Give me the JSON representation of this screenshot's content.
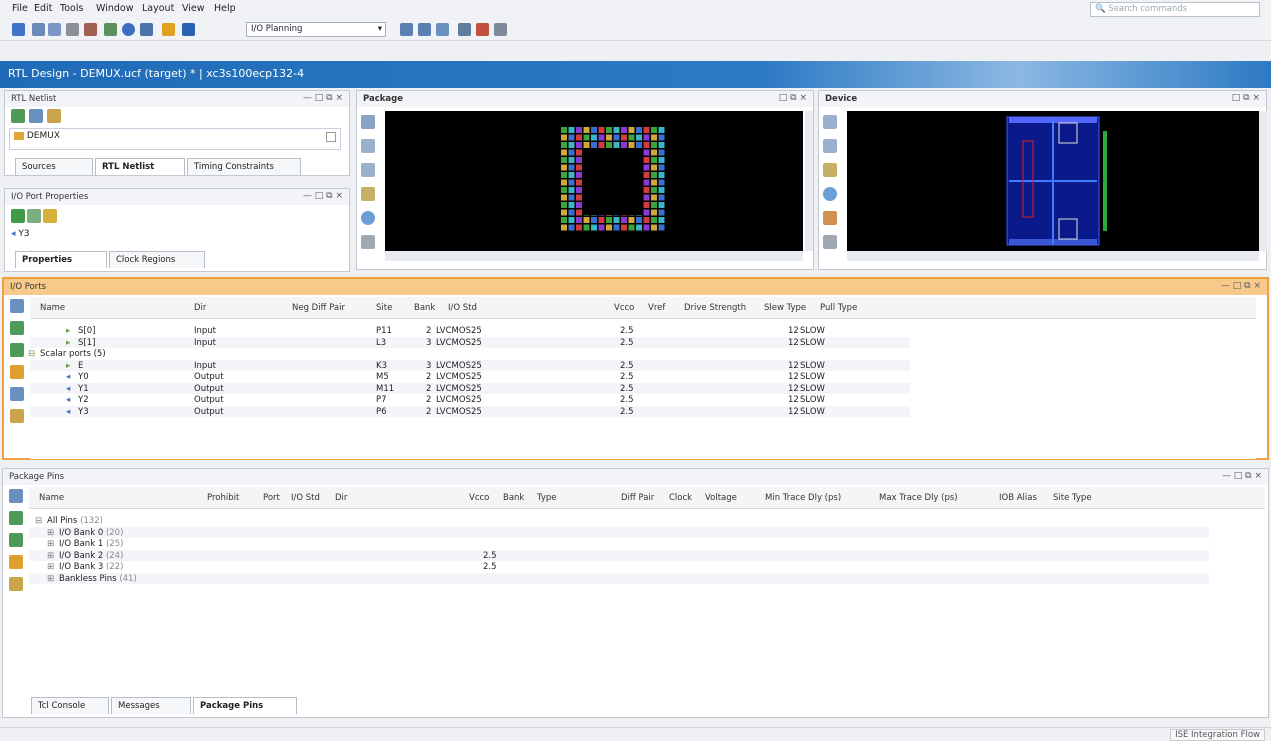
{
  "menu": [
    "File",
    "Edit",
    "Tools",
    "Window",
    "Layout",
    "View",
    "Help"
  ],
  "search_placeholder": "Search commands",
  "layout_select": "I/O Planning",
  "title": "RTL Design - DEMUX.ucf (target) * | xc3s100ecp132-4",
  "rtl_netlist": {
    "title": "RTL Netlist",
    "tree_item": "DEMUX",
    "tabs": [
      "Sources",
      "RTL Netlist",
      "Timing Constraints"
    ]
  },
  "io_port_props": {
    "title": "I/O Port Properties",
    "item": "Y3",
    "tabs": [
      "Properties",
      "Clock Regions"
    ]
  },
  "package_panel": {
    "title": "Package"
  },
  "device_panel": {
    "title": "Device"
  },
  "io_ports": {
    "title": "I/O Ports",
    "columns": [
      "Name",
      "Dir",
      "Neg Diff Pair",
      "Site",
      "Bank",
      "I/O Std",
      "Vcco",
      "Vref",
      "Drive Strength",
      "Slew Type",
      "Pull Type"
    ],
    "rows": [
      {
        "name": "S[0]",
        "dir": "Input",
        "site": "P11",
        "bank": "2",
        "iostd": "LVCMOS25",
        "vcco": "2.5",
        "drive": "12",
        "slew": "SLOW",
        "indent": 3
      },
      {
        "name": "S[1]",
        "dir": "Input",
        "site": "L3",
        "bank": "3",
        "iostd": "LVCMOS25",
        "vcco": "2.5",
        "drive": "12",
        "slew": "SLOW",
        "indent": 3
      },
      {
        "name": "Scalar ports (5)",
        "dir": "",
        "site": "",
        "bank": "",
        "iostd": "",
        "vcco": "",
        "drive": "",
        "slew": "",
        "indent": 2
      },
      {
        "name": "E",
        "dir": "Input",
        "site": "K3",
        "bank": "3",
        "iostd": "LVCMOS25",
        "vcco": "2.5",
        "drive": "12",
        "slew": "SLOW",
        "indent": 3
      },
      {
        "name": "Y0",
        "dir": "Output",
        "site": "M5",
        "bank": "2",
        "iostd": "LVCMOS25",
        "vcco": "2.5",
        "drive": "12",
        "slew": "SLOW",
        "indent": 3
      },
      {
        "name": "Y1",
        "dir": "Output",
        "site": "M11",
        "bank": "2",
        "iostd": "LVCMOS25",
        "vcco": "2.5",
        "drive": "12",
        "slew": "SLOW",
        "indent": 3
      },
      {
        "name": "Y2",
        "dir": "Output",
        "site": "P7",
        "bank": "2",
        "iostd": "LVCMOS25",
        "vcco": "2.5",
        "drive": "12",
        "slew": "SLOW",
        "indent": 3
      },
      {
        "name": "Y3",
        "dir": "Output",
        "site": "P6",
        "bank": "2",
        "iostd": "LVCMOS25",
        "vcco": "2.5",
        "drive": "12",
        "slew": "SLOW",
        "indent": 3
      }
    ]
  },
  "package_pins": {
    "title": "Package Pins",
    "columns": [
      "Name",
      "Prohibit",
      "Port",
      "I/O Std",
      "Dir",
      "Vcco",
      "Bank",
      "Type",
      "Diff Pair",
      "Clock",
      "Voltage",
      "Min Trace Dly (ps)",
      "Max Trace Dly (ps)",
      "IOB Alias",
      "Site Type"
    ],
    "rows": [
      {
        "name": "All Pins",
        "count": "(132)",
        "vcco": "",
        "indent": 1
      },
      {
        "name": "I/O Bank 0",
        "count": "(20)",
        "vcco": "",
        "indent": 2
      },
      {
        "name": "I/O Bank 1",
        "count": "(25)",
        "vcco": "",
        "indent": 2
      },
      {
        "name": "I/O Bank 2",
        "count": "(24)",
        "vcco": "2.5",
        "indent": 2
      },
      {
        "name": "I/O Bank 3",
        "count": "(22)",
        "vcco": "2.5",
        "indent": 2
      },
      {
        "name": "Bankless Pins",
        "count": "(41)",
        "vcco": "",
        "indent": 2
      }
    ]
  },
  "bottom_tabs": [
    "Tcl Console",
    "Messages",
    "Package Pins"
  ],
  "status_right": "ISE Integration Flow"
}
